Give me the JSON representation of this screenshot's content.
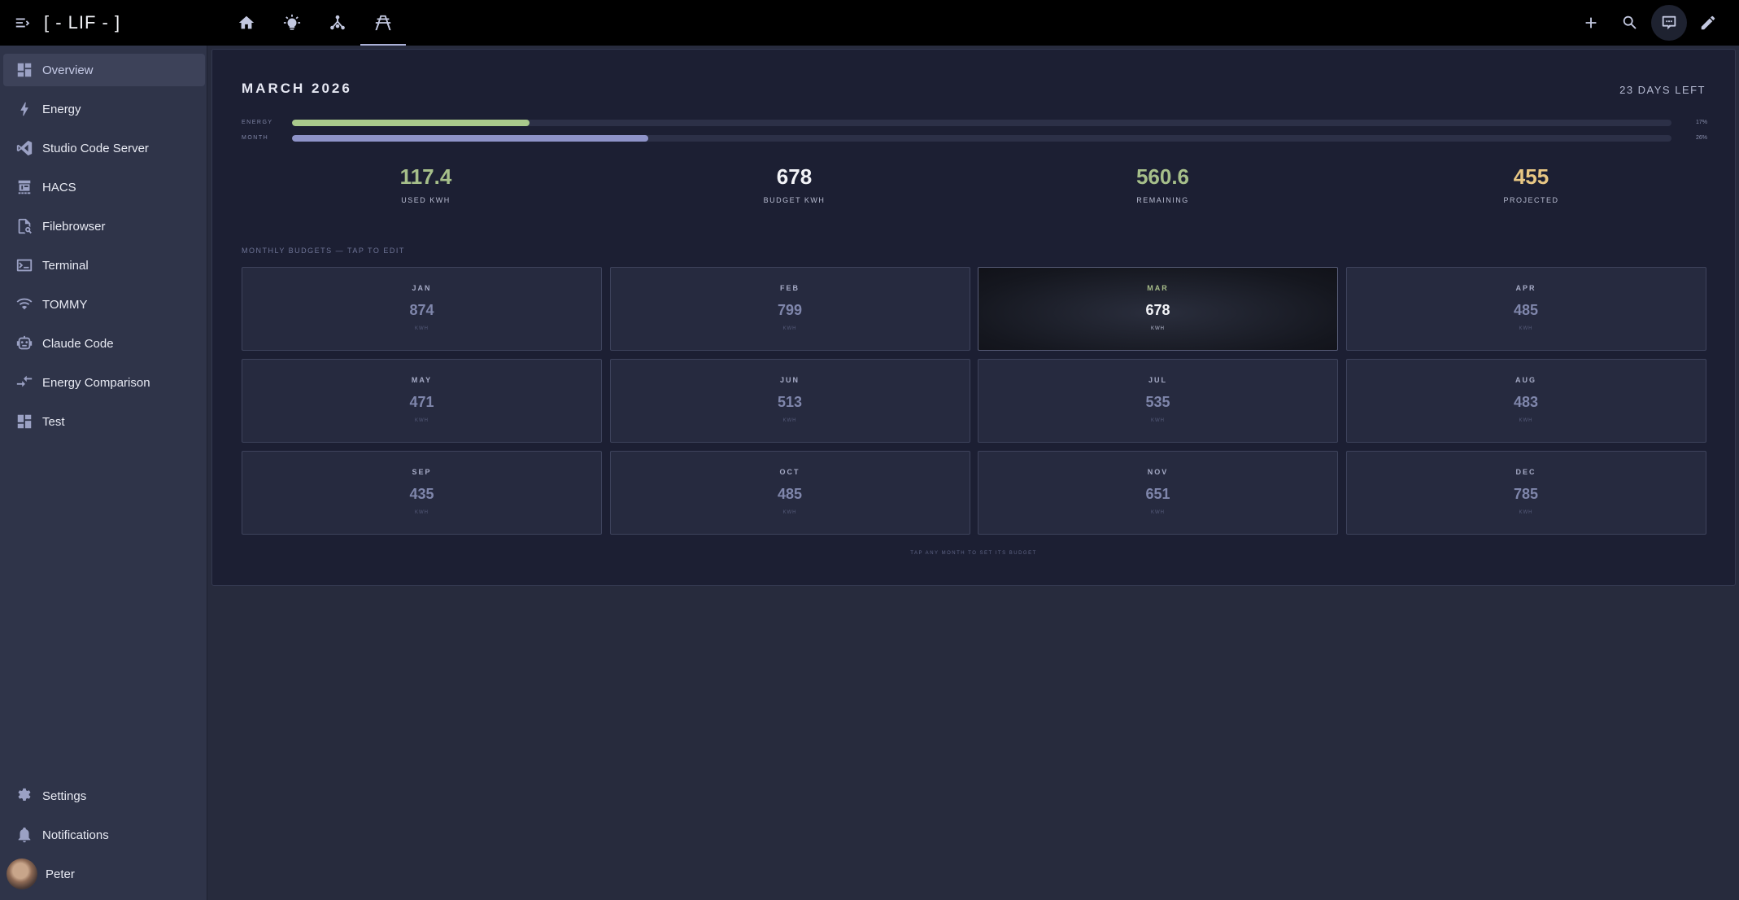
{
  "app": {
    "title": "[ - LIF - ]"
  },
  "topbar": {
    "view_tabs": [
      {
        "icon": "home-icon"
      },
      {
        "icon": "lightbulb-icon"
      },
      {
        "icon": "network-icon"
      },
      {
        "icon": "transmission-tower-icon",
        "active": true
      }
    ],
    "actions": [
      {
        "icon": "plus-icon"
      },
      {
        "icon": "search-icon"
      },
      {
        "icon": "assist-chat-icon"
      },
      {
        "icon": "pencil-icon"
      }
    ]
  },
  "sidebar": {
    "items": [
      {
        "label": "Overview",
        "icon": "view-dashboard-icon",
        "active": true
      },
      {
        "label": "Energy",
        "icon": "lightning-bolt-icon"
      },
      {
        "label": "Studio Code Server",
        "icon": "vscode-icon"
      },
      {
        "label": "HACS",
        "icon": "hacs-icon"
      },
      {
        "label": "Filebrowser",
        "icon": "file-search-icon"
      },
      {
        "label": "Terminal",
        "icon": "console-icon"
      },
      {
        "label": "TOMMY",
        "icon": "wifi-icon"
      },
      {
        "label": "Claude Code",
        "icon": "robot-icon"
      },
      {
        "label": "Energy Comparison",
        "icon": "compare-icon"
      },
      {
        "label": "Test",
        "icon": "view-dashboard-icon"
      }
    ],
    "bottom": {
      "settings": "Settings",
      "notifications": "Notifications",
      "user": "Peter"
    }
  },
  "budget": {
    "title": "MARCH 2026",
    "days_left": "23 DAYS LEFT",
    "bars": [
      {
        "label": "ENERGY",
        "pct_text": "17%",
        "fraction": 0.172,
        "color": "#a9c98c"
      },
      {
        "label": "MONTH",
        "pct_text": "26%",
        "fraction": 0.258,
        "color": "#8e93c9"
      }
    ],
    "stats": [
      {
        "value": "117.4",
        "label": "USED KWH",
        "color": "#a6bf8a"
      },
      {
        "value": "678",
        "label": "BUDGET KWH",
        "color": "#f2f3f7"
      },
      {
        "value": "560.6",
        "label": "REMAINING",
        "color": "#a6bf8a"
      },
      {
        "value": "455",
        "label": "PROJECTED",
        "color": "#e8c784"
      }
    ],
    "section_label": "MONTHLY BUDGETS — TAP TO EDIT",
    "months": [
      {
        "name": "JAN",
        "value": "874",
        "unit": "KWH"
      },
      {
        "name": "FEB",
        "value": "799",
        "unit": "KWH"
      },
      {
        "name": "MAR",
        "value": "678",
        "unit": "KWH",
        "current": true
      },
      {
        "name": "APR",
        "value": "485",
        "unit": "KWH"
      },
      {
        "name": "MAY",
        "value": "471",
        "unit": "KWH"
      },
      {
        "name": "JUN",
        "value": "513",
        "unit": "KWH"
      },
      {
        "name": "JUL",
        "value": "535",
        "unit": "KWH"
      },
      {
        "name": "AUG",
        "value": "483",
        "unit": "KWH"
      },
      {
        "name": "SEP",
        "value": "435",
        "unit": "KWH"
      },
      {
        "name": "OCT",
        "value": "485",
        "unit": "KWH"
      },
      {
        "name": "NOV",
        "value": "651",
        "unit": "KWH"
      },
      {
        "name": "DEC",
        "value": "785",
        "unit": "KWH"
      }
    ],
    "footer_hint": "TAP ANY MONTH TO SET ITS BUDGET"
  }
}
